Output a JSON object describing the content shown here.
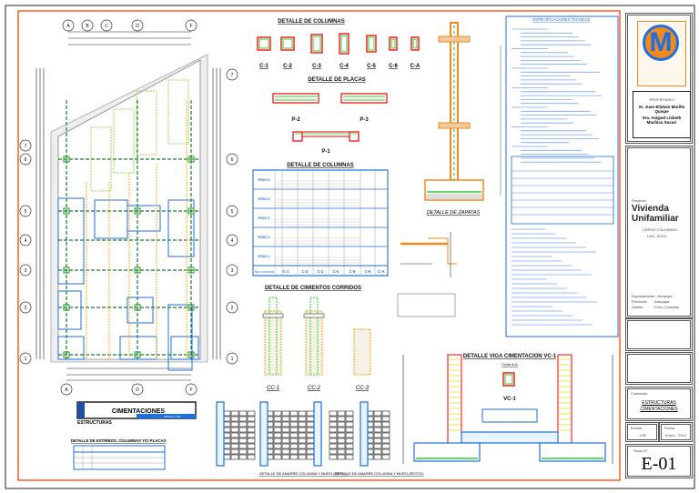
{
  "plan": {
    "axes_top": [
      "A",
      "B",
      "C",
      "D",
      "F"
    ],
    "axes_bottom": [
      "A",
      "D",
      "F"
    ],
    "axes_left": [
      "7",
      "6",
      "5",
      "4",
      "3",
      "2",
      "1"
    ],
    "axes_right": [
      "7",
      "6",
      "5",
      "4",
      "3",
      "2",
      "1"
    ],
    "title_box": {
      "title": "CIMENTACIONES",
      "subtitle": "ESTRUCTURAS",
      "scale": "ESCALA 1:50"
    }
  },
  "stirrup_table": {
    "title": "DETALLE DE ESTRIBOS, COLUMNAS Y/O PLACAS"
  },
  "columns_detail": {
    "title": "DETALLE DE COLUMNAS",
    "labels": [
      "C-1",
      "C-2",
      "C-3",
      "C-4",
      "C-5",
      "C-6",
      "C-A"
    ]
  },
  "plates_detail": {
    "title": "DETALLE DE PLACAS",
    "labels": [
      "P-2",
      "P-3",
      "P-1"
    ]
  },
  "columns_table": {
    "title": "DETALLE DE COLUMNAS",
    "rows": [
      "PISO 5",
      "PISO 4",
      "PISO 3",
      "PISO 2",
      "PISO 1"
    ],
    "footer_label": "Tipo columna",
    "types": [
      "C-1",
      "C-2",
      "C-3",
      "C-4",
      "C-5",
      "C-6",
      "C-A"
    ]
  },
  "strip_footings": {
    "title": "DETALLE DE CIMIENTOS CORRIDOS",
    "labels": [
      "CC-1",
      "CC-2",
      "CC-3"
    ]
  },
  "wall_ties": {
    "label1": "DETALLE DE AMARRE COLUMNA Y MURO (PISO 1)",
    "label2": "DETALLE DE AMARRE COLUMNA Y MURO (RESTO)"
  },
  "footing_detail": {
    "title": "DETALLE DE ZAPATAS"
  },
  "specs": {
    "title": "ESPECIFICACIONES TECNICAS"
  },
  "beam_detail": {
    "title": "DETALLE VIGA CIMENTACION VC-1",
    "section": "Corte A-A",
    "label": "VC-1"
  },
  "title_block": {
    "owner_label": "PROPIETARIO",
    "owners": [
      "Sr. Juan Elisban Murillo Quispe",
      "Sra. Avigael Lisbeth Machica Sucari"
    ],
    "project_label": "Proyecto",
    "project": "Vivienda Unifamiliar",
    "location1": "CERRO COLORADO",
    "location2": "LNG. XXXX",
    "dept": "Departamento : Arequipa",
    "prov": "Provincia      : Arequipa",
    "dist": "Distrito         : Cerro Colorado",
    "sheet_type_label": "Contenido",
    "sheet_type": "ESTRUCTURAS",
    "sheet_content": "CIMENTACIONES",
    "scale_label": "Escala",
    "scale": "1:50",
    "date_label": "Fecha",
    "date": "Enero - 2014",
    "sheet_label": "Plano N°",
    "sheet_no": "E-01"
  },
  "colors": {
    "border": "#ff5a1f",
    "rebar": "#33cc33",
    "concrete": "#ff0000",
    "blue": "#1e6fe0",
    "orange": "#f08a1e"
  }
}
